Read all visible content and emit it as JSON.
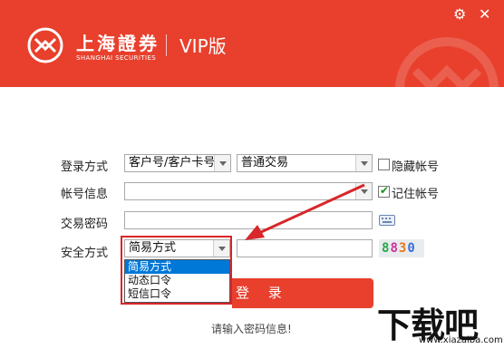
{
  "header": {
    "brand_cn": "上海證券",
    "brand_en": "SHANGHAI SECURITIES",
    "edition": "VIP版",
    "bg_color": "#e8402d",
    "icons": [
      "gear-icon",
      "close-icon"
    ]
  },
  "form": {
    "login_method": {
      "label": "登录方式",
      "account_type": "客户号/客户卡号",
      "trade_type": "普通交易",
      "hide_account_label": "隐藏帐号",
      "hide_account_checked": false
    },
    "account": {
      "label": "帐号信息",
      "value": "",
      "remember_label": "记住帐号",
      "remember_checked": true
    },
    "password": {
      "label": "交易密码",
      "value": ""
    },
    "security": {
      "label": "安全方式",
      "selected": "简易方式",
      "options": [
        "简易方式",
        "动态口令",
        "短信口令"
      ],
      "captcha_input": "",
      "captcha_chars": [
        "8",
        "8",
        "3",
        "0"
      ]
    },
    "login_button": "登 录",
    "status": "请输入密码信息!"
  },
  "watermark": {
    "cn": "下载吧",
    "en": "www.xiazaiba.com"
  },
  "colors": {
    "accent": "#e8402d",
    "highlight": "#d8262a",
    "selection": "#0078d7",
    "captcha": [
      "#2aa84a",
      "#d0329b",
      "#e87820",
      "#3a6fd8"
    ]
  }
}
